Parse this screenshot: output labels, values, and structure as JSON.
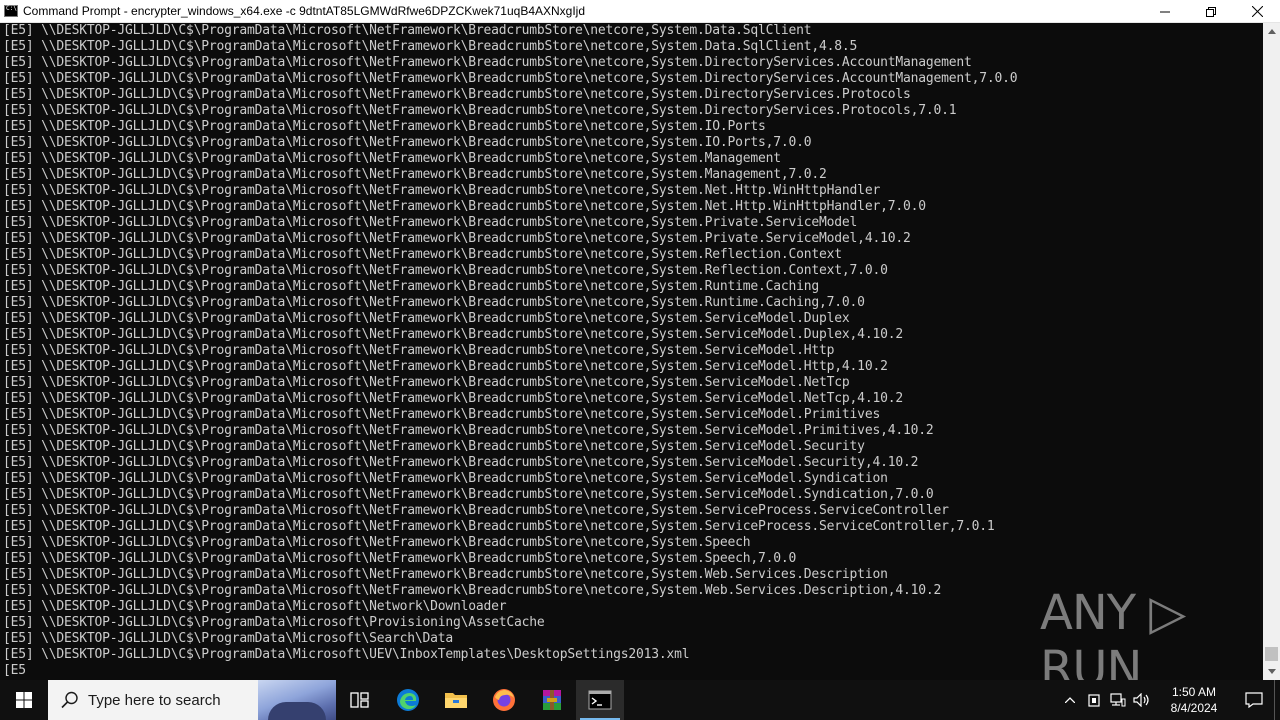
{
  "window": {
    "title": "Command Prompt - encrypter_windows_x64.exe  -c 9dtntAT85LGMWdRfwe6DPZCKwek71uqB4AXNxgIjd",
    "controls": {
      "minimize": "—",
      "maximize": "❐",
      "close": "✕"
    }
  },
  "console": {
    "lines": [
      "[E5] \\\\DESKTOP-JGLLJLD\\C$\\ProgramData\\Microsoft\\NetFramework\\BreadcrumbStore\\netcore,System.Data.SqlClient",
      "[E5] \\\\DESKTOP-JGLLJLD\\C$\\ProgramData\\Microsoft\\NetFramework\\BreadcrumbStore\\netcore,System.Data.SqlClient,4.8.5",
      "[E5] \\\\DESKTOP-JGLLJLD\\C$\\ProgramData\\Microsoft\\NetFramework\\BreadcrumbStore\\netcore,System.DirectoryServices.AccountManagement",
      "[E5] \\\\DESKTOP-JGLLJLD\\C$\\ProgramData\\Microsoft\\NetFramework\\BreadcrumbStore\\netcore,System.DirectoryServices.AccountManagement,7.0.0",
      "[E5] \\\\DESKTOP-JGLLJLD\\C$\\ProgramData\\Microsoft\\NetFramework\\BreadcrumbStore\\netcore,System.DirectoryServices.Protocols",
      "[E5] \\\\DESKTOP-JGLLJLD\\C$\\ProgramData\\Microsoft\\NetFramework\\BreadcrumbStore\\netcore,System.DirectoryServices.Protocols,7.0.1",
      "[E5] \\\\DESKTOP-JGLLJLD\\C$\\ProgramData\\Microsoft\\NetFramework\\BreadcrumbStore\\netcore,System.IO.Ports",
      "[E5] \\\\DESKTOP-JGLLJLD\\C$\\ProgramData\\Microsoft\\NetFramework\\BreadcrumbStore\\netcore,System.IO.Ports,7.0.0",
      "[E5] \\\\DESKTOP-JGLLJLD\\C$\\ProgramData\\Microsoft\\NetFramework\\BreadcrumbStore\\netcore,System.Management",
      "[E5] \\\\DESKTOP-JGLLJLD\\C$\\ProgramData\\Microsoft\\NetFramework\\BreadcrumbStore\\netcore,System.Management,7.0.2",
      "[E5] \\\\DESKTOP-JGLLJLD\\C$\\ProgramData\\Microsoft\\NetFramework\\BreadcrumbStore\\netcore,System.Net.Http.WinHttpHandler",
      "[E5] \\\\DESKTOP-JGLLJLD\\C$\\ProgramData\\Microsoft\\NetFramework\\BreadcrumbStore\\netcore,System.Net.Http.WinHttpHandler,7.0.0",
      "[E5] \\\\DESKTOP-JGLLJLD\\C$\\ProgramData\\Microsoft\\NetFramework\\BreadcrumbStore\\netcore,System.Private.ServiceModel",
      "[E5] \\\\DESKTOP-JGLLJLD\\C$\\ProgramData\\Microsoft\\NetFramework\\BreadcrumbStore\\netcore,System.Private.ServiceModel,4.10.2",
      "[E5] \\\\DESKTOP-JGLLJLD\\C$\\ProgramData\\Microsoft\\NetFramework\\BreadcrumbStore\\netcore,System.Reflection.Context",
      "[E5] \\\\DESKTOP-JGLLJLD\\C$\\ProgramData\\Microsoft\\NetFramework\\BreadcrumbStore\\netcore,System.Reflection.Context,7.0.0",
      "[E5] \\\\DESKTOP-JGLLJLD\\C$\\ProgramData\\Microsoft\\NetFramework\\BreadcrumbStore\\netcore,System.Runtime.Caching",
      "[E5] \\\\DESKTOP-JGLLJLD\\C$\\ProgramData\\Microsoft\\NetFramework\\BreadcrumbStore\\netcore,System.Runtime.Caching,7.0.0",
      "[E5] \\\\DESKTOP-JGLLJLD\\C$\\ProgramData\\Microsoft\\NetFramework\\BreadcrumbStore\\netcore,System.ServiceModel.Duplex",
      "[E5] \\\\DESKTOP-JGLLJLD\\C$\\ProgramData\\Microsoft\\NetFramework\\BreadcrumbStore\\netcore,System.ServiceModel.Duplex,4.10.2",
      "[E5] \\\\DESKTOP-JGLLJLD\\C$\\ProgramData\\Microsoft\\NetFramework\\BreadcrumbStore\\netcore,System.ServiceModel.Http",
      "[E5] \\\\DESKTOP-JGLLJLD\\C$\\ProgramData\\Microsoft\\NetFramework\\BreadcrumbStore\\netcore,System.ServiceModel.Http,4.10.2",
      "[E5] \\\\DESKTOP-JGLLJLD\\C$\\ProgramData\\Microsoft\\NetFramework\\BreadcrumbStore\\netcore,System.ServiceModel.NetTcp",
      "[E5] \\\\DESKTOP-JGLLJLD\\C$\\ProgramData\\Microsoft\\NetFramework\\BreadcrumbStore\\netcore,System.ServiceModel.NetTcp,4.10.2",
      "[E5] \\\\DESKTOP-JGLLJLD\\C$\\ProgramData\\Microsoft\\NetFramework\\BreadcrumbStore\\netcore,System.ServiceModel.Primitives",
      "[E5] \\\\DESKTOP-JGLLJLD\\C$\\ProgramData\\Microsoft\\NetFramework\\BreadcrumbStore\\netcore,System.ServiceModel.Primitives,4.10.2",
      "[E5] \\\\DESKTOP-JGLLJLD\\C$\\ProgramData\\Microsoft\\NetFramework\\BreadcrumbStore\\netcore,System.ServiceModel.Security",
      "[E5] \\\\DESKTOP-JGLLJLD\\C$\\ProgramData\\Microsoft\\NetFramework\\BreadcrumbStore\\netcore,System.ServiceModel.Security,4.10.2",
      "[E5] \\\\DESKTOP-JGLLJLD\\C$\\ProgramData\\Microsoft\\NetFramework\\BreadcrumbStore\\netcore,System.ServiceModel.Syndication",
      "[E5] \\\\DESKTOP-JGLLJLD\\C$\\ProgramData\\Microsoft\\NetFramework\\BreadcrumbStore\\netcore,System.ServiceModel.Syndication,7.0.0",
      "[E5] \\\\DESKTOP-JGLLJLD\\C$\\ProgramData\\Microsoft\\NetFramework\\BreadcrumbStore\\netcore,System.ServiceProcess.ServiceController",
      "[E5] \\\\DESKTOP-JGLLJLD\\C$\\ProgramData\\Microsoft\\NetFramework\\BreadcrumbStore\\netcore,System.ServiceProcess.ServiceController,7.0.1",
      "[E5] \\\\DESKTOP-JGLLJLD\\C$\\ProgramData\\Microsoft\\NetFramework\\BreadcrumbStore\\netcore,System.Speech",
      "[E5] \\\\DESKTOP-JGLLJLD\\C$\\ProgramData\\Microsoft\\NetFramework\\BreadcrumbStore\\netcore,System.Speech,7.0.0",
      "[E5] \\\\DESKTOP-JGLLJLD\\C$\\ProgramData\\Microsoft\\NetFramework\\BreadcrumbStore\\netcore,System.Web.Services.Description",
      "[E5] \\\\DESKTOP-JGLLJLD\\C$\\ProgramData\\Microsoft\\NetFramework\\BreadcrumbStore\\netcore,System.Web.Services.Description,4.10.2",
      "[E5] \\\\DESKTOP-JGLLJLD\\C$\\ProgramData\\Microsoft\\Network\\Downloader",
      "[E5] \\\\DESKTOP-JGLLJLD\\C$\\ProgramData\\Microsoft\\Provisioning\\AssetCache",
      "[E5] \\\\DESKTOP-JGLLJLD\\C$\\ProgramData\\Microsoft\\Search\\Data",
      "[E5] \\\\DESKTOP-JGLLJLD\\C$\\ProgramData\\Microsoft\\UEV\\InboxTemplates\\DesktopSettings2013.xml",
      "[E5"
    ],
    "text_color": "#cccccc",
    "background": "#0c0c0c"
  },
  "scrollbar": {
    "up_icon": "chevron-up-icon",
    "down_icon": "chevron-down-icon",
    "position": 0.98
  },
  "watermark": {
    "text": "ANY ▷ RUN"
  },
  "taskbar": {
    "search_placeholder": "Type here to search",
    "pinned": [
      {
        "name": "task-view-icon"
      },
      {
        "name": "edge-icon"
      },
      {
        "name": "file-explorer-icon"
      },
      {
        "name": "firefox-icon"
      },
      {
        "name": "winrar-icon"
      },
      {
        "name": "command-prompt-icon",
        "active": true
      }
    ],
    "tray": {
      "chevron": "^",
      "clock_time": "1:50 AM",
      "clock_date": "8/4/2024"
    }
  }
}
